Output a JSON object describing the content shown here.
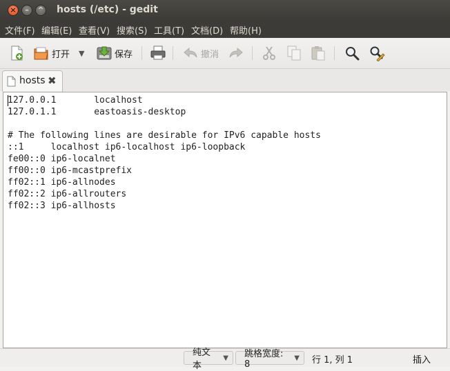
{
  "window": {
    "title": "hosts (/etc) - gedit"
  },
  "menu": [
    "文件(F)",
    "编辑(E)",
    "查看(V)",
    "搜索(S)",
    "工具(T)",
    "文档(D)",
    "帮助(H)"
  ],
  "toolbar": {
    "open_label": "打开",
    "save_label": "保存",
    "undo_label": "撤消"
  },
  "tab": {
    "label": "hosts"
  },
  "editor": {
    "lines": [
      "127.0.0.1       localhost",
      "127.0.1.1       eastoasis-desktop",
      "",
      "# The following lines are desirable for IPv6 capable hosts",
      "::1     localhost ip6-localhost ip6-loopback",
      "fe00::0 ip6-localnet",
      "ff00::0 ip6-mcastprefix",
      "ff02::1 ip6-allnodes",
      "ff02::2 ip6-allrouters",
      "ff02::3 ip6-allhosts"
    ]
  },
  "status": {
    "language": "纯文本",
    "tab_width": "跳格宽度: 8",
    "position": "行 1, 列 1",
    "mode": "插入"
  },
  "colors": {
    "titlebar": "#3c3b37",
    "close_button": "#df4a16",
    "editor_bg": "#ffffff"
  }
}
